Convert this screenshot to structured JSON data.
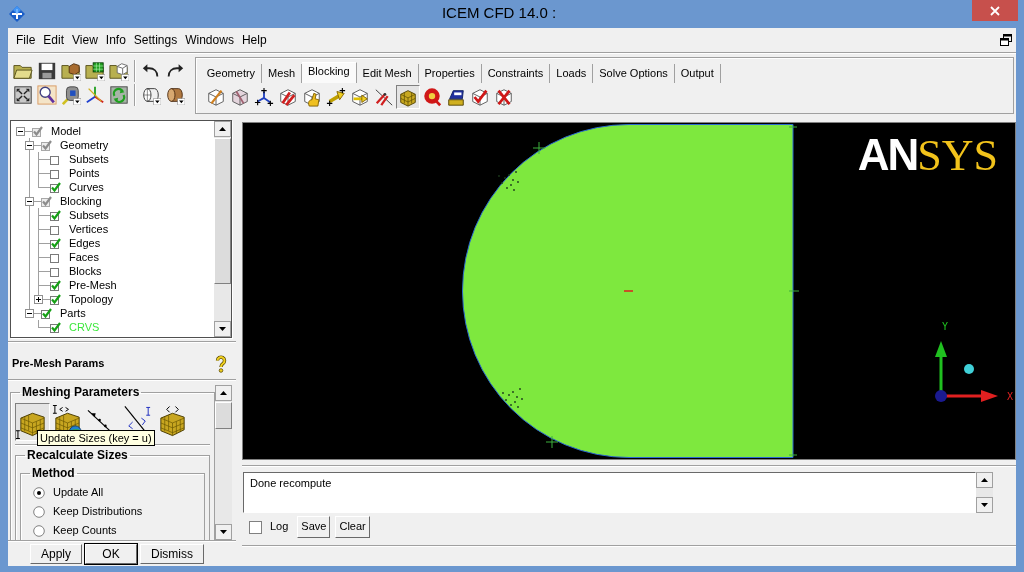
{
  "window": {
    "title": "ICEM CFD 14.0 :"
  },
  "menu": [
    "File",
    "Edit",
    "View",
    "Info",
    "Settings",
    "Windows",
    "Help"
  ],
  "function_tabs": [
    {
      "label": "Geometry",
      "selected": false
    },
    {
      "label": "Mesh",
      "selected": false
    },
    {
      "label": "Blocking",
      "selected": true
    },
    {
      "label": "Edit Mesh",
      "selected": false
    },
    {
      "label": "Properties",
      "selected": false
    },
    {
      "label": "Constraints",
      "selected": false
    },
    {
      "label": "Loads",
      "selected": false
    },
    {
      "label": "Solve Options",
      "selected": false
    },
    {
      "label": "Output",
      "selected": false
    }
  ],
  "tab_tools": [
    {
      "selected": false
    },
    {
      "selected": false
    },
    {
      "selected": false
    },
    {
      "selected": false
    },
    {
      "selected": false
    },
    {
      "selected": false
    },
    {
      "selected": false
    },
    {
      "selected": false
    },
    {
      "selected": true
    },
    {
      "selected": false
    },
    {
      "selected": false
    },
    {
      "selected": false
    },
    {
      "selected": false
    }
  ],
  "model_tree": [
    {
      "label": "Model",
      "checked": true,
      "greyed": true,
      "expanded": true,
      "children": [
        {
          "label": "Geometry",
          "checked": true,
          "greyed": true,
          "expanded": true,
          "children": [
            {
              "label": "Subsets",
              "checked": false,
              "greyed": false
            },
            {
              "label": "Points",
              "checked": false,
              "greyed": false
            },
            {
              "label": "Curves",
              "checked": true,
              "greyed": false
            }
          ]
        },
        {
          "label": "Blocking",
          "checked": true,
          "greyed": true,
          "expanded": true,
          "children": [
            {
              "label": "Subsets",
              "checked": true,
              "greyed": false
            },
            {
              "label": "Vertices",
              "checked": false,
              "greyed": false
            },
            {
              "label": "Edges",
              "checked": true,
              "greyed": false
            },
            {
              "label": "Faces",
              "checked": false,
              "greyed": false
            },
            {
              "label": "Blocks",
              "checked": false,
              "greyed": false
            },
            {
              "label": "Pre-Mesh",
              "checked": true,
              "greyed": false
            },
            {
              "label": "Topology",
              "checked": true,
              "greyed": false,
              "expanded": false
            }
          ]
        },
        {
          "label": "Parts",
          "checked": true,
          "greyed": false,
          "expanded": true,
          "children": [
            {
              "label": "CRVS",
              "checked": true,
              "greyed": false,
              "color": "#3de83d"
            }
          ]
        }
      ]
    }
  ],
  "params_panel": {
    "title": "Pre-Mesh Params",
    "group": "Meshing Parameters",
    "tools": [
      {
        "selected": true
      },
      {
        "selected": false
      },
      {
        "selected": false
      },
      {
        "selected": false
      },
      {
        "selected": false
      }
    ],
    "tooltip": "Update Sizes (key = u)",
    "section": "Recalculate Sizes",
    "subsection": "Method",
    "options": [
      {
        "label": "Update All",
        "selected": true
      },
      {
        "label": "Keep Distributions",
        "selected": false
      },
      {
        "label": "Keep Counts",
        "selected": false
      }
    ],
    "buttons": [
      {
        "label": "Apply",
        "default": false
      },
      {
        "label": "OK",
        "default": true
      },
      {
        "label": "Dismiss",
        "default": false
      }
    ]
  },
  "viewport": {
    "logo": {
      "part_1": "AN",
      "part_2": "SYS"
    },
    "axes": {
      "y_label": "Y",
      "x_label": "X"
    }
  },
  "messages": {
    "text": "Done recompute",
    "log": {
      "label": "Log",
      "checked": false
    },
    "buttons": [
      "Save",
      "Clear"
    ]
  }
}
